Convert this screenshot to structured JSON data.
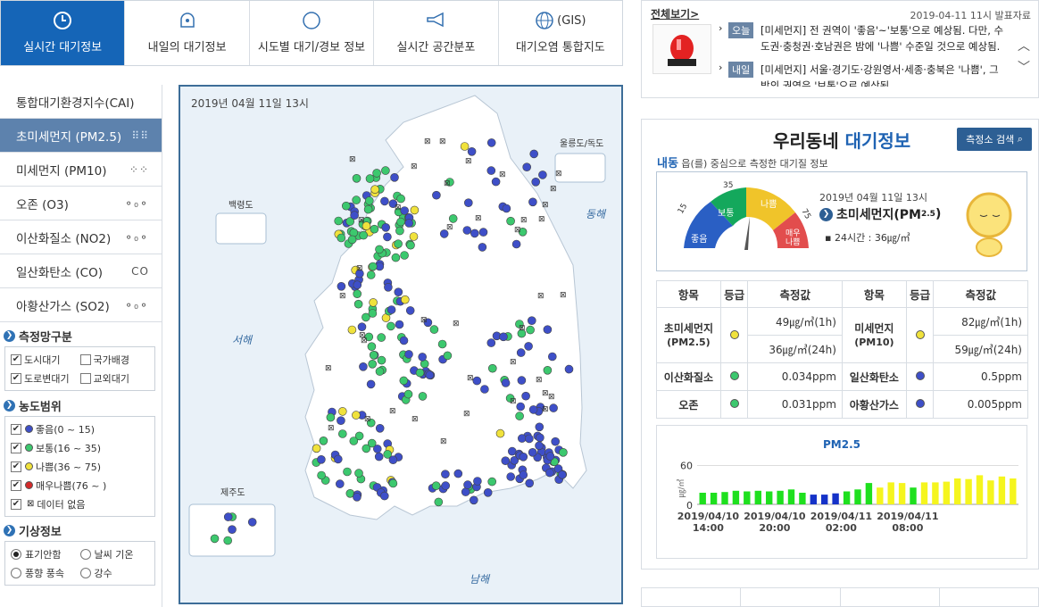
{
  "tabs": [
    {
      "label": "실시간 대기정보",
      "icon": "clock-icon",
      "active": true
    },
    {
      "label": "내일의 대기정보",
      "icon": "forecast-icon",
      "active": false
    },
    {
      "label": "시도별 대기/경보 정보",
      "icon": "compass-icon",
      "active": false
    },
    {
      "label": "실시간 공간분포",
      "icon": "megaphone-icon",
      "active": false
    },
    {
      "label": "대기오염 통합지도",
      "icon": "globe-icon",
      "icon_text": "(GIS)",
      "active": false
    }
  ],
  "menu": [
    {
      "label": "통합대기환경지수(CAI)",
      "icon": ""
    },
    {
      "label": "초미세먼지 (PM2.5)",
      "icon": "⠿⠿",
      "active": true
    },
    {
      "label": "미세먼지 (PM10)",
      "icon": "⁘⁘"
    },
    {
      "label": "오존 (O3)",
      "icon": "⚬₀⚬"
    },
    {
      "label": "이산화질소 (NO2)",
      "icon": "⚬₀⚬"
    },
    {
      "label": "일산화탄소 (CO)",
      "icon": "CO"
    },
    {
      "label": "아황산가스 (SO2)",
      "icon": "⚬₀⚬"
    }
  ],
  "network": {
    "title": "측정망구분",
    "items": [
      {
        "label": "도시대기",
        "checked": true
      },
      {
        "label": "국가배경",
        "checked": false
      },
      {
        "label": "도로변대기",
        "checked": true
      },
      {
        "label": "교외대기",
        "checked": false
      }
    ]
  },
  "range": {
    "title": "농도범위",
    "items": [
      {
        "label": "좋음(0 ~ 15)",
        "color": "#3e4fc8",
        "checked": true
      },
      {
        "label": "보통(16 ~ 35)",
        "color": "#3cc86e",
        "checked": true
      },
      {
        "label": "나쁨(36 ~ 75)",
        "color": "#f0e23c",
        "checked": true
      },
      {
        "label": "매우나쁨(76 ~ )",
        "color": "#d42a2a",
        "checked": true
      },
      {
        "label": "데이터 없음",
        "color": "none",
        "checked": true
      }
    ]
  },
  "weather": {
    "title": "기상정보",
    "items": [
      {
        "label": "표기안함",
        "on": true
      },
      {
        "label": "날씨 기온",
        "on": false
      },
      {
        "label": "풍향 풍속",
        "on": false
      },
      {
        "label": "강수",
        "on": false
      }
    ]
  },
  "map": {
    "timestamp": "2019년 04월 11일 13시",
    "labels": {
      "baek": "백령도",
      "ulleung": "울릉도/독도",
      "jeju": "제주도",
      "west_sea": "서해",
      "east_sea": "동해",
      "south_sea": "남해"
    }
  },
  "notice": {
    "view_all": "전체보기>",
    "date": "2019-04-11 11시 발표자료",
    "today_tag": "오늘",
    "tomorrow_tag": "내일",
    "today_text": "[미세먼지] 전 권역이 '좋음'~'보통'으로 예상됨. 다만, 수도권·충청권·호남권은 밤에 '나쁨' 수준일 것으로 예상됨.",
    "tomorrow_text": "[미세먼지] 서울·경기도·강원영서·세종·충북은 '나쁨', 그 밖의 권역은 '보통'으로 예상됨."
  },
  "air": {
    "title_a": "우리동네",
    "title_b": "대기정보",
    "search_btn": "측정소 검색",
    "station": "내동",
    "station_desc": "읍(를) 중심으로 측정한 대기질 정보",
    "gauge": {
      "good": "좋음",
      "normal": "보통",
      "bad": "나쁨",
      "very_bad": "매우\n나쁨",
      "t15": "15",
      "t35": "35",
      "t75": "75",
      "value": 49
    },
    "ts": "2019년 04월 11일 13시",
    "pollutant": "초미세먼지(PM",
    "pollutant_sub": "2.5",
    "avg24": "24시간 : 36㎍/㎥"
  },
  "table": {
    "headers": [
      "항목",
      "등급",
      "측정값",
      "항목",
      "등급",
      "측정값"
    ],
    "rows": [
      {
        "name1": "초미세먼지",
        "sub1": "(PM2.5)",
        "grade1": "#f0e23c",
        "val1a": "49㎍/㎥(1h)",
        "val1b": "36㎍/㎥(24h)",
        "name2": "미세먼지",
        "sub2": "(PM10)",
        "grade2": "#f0e23c",
        "val2a": "82㎍/㎥(1h)",
        "val2b": "59㎍/㎥(24h)"
      },
      {
        "name1": "이산화질소",
        "grade1": "#3cc86e",
        "val1": "0.034ppm",
        "name2": "일산화탄소",
        "grade2": "#3e4fc8",
        "val2": "0.5ppm"
      },
      {
        "name1": "오존",
        "grade1": "#3cc86e",
        "val1": "0.031ppm",
        "name2": "아황산가스",
        "grade2": "#3e4fc8",
        "val2": "0.005ppm"
      }
    ]
  },
  "chart_data": {
    "type": "bar",
    "title": "PM2.5",
    "ylabel": "㎍/㎥",
    "ylim": [
      0,
      80
    ],
    "yticks": [
      "60",
      "0"
    ],
    "xticks": [
      "2019/04/10\n14:00",
      "2019/04/10\n20:00",
      "2019/04/11\n02:00",
      "2019/04/11\n08:00"
    ],
    "values": [
      18,
      18,
      19,
      21,
      20,
      21,
      20,
      21,
      23,
      18,
      15,
      15,
      17,
      20,
      23,
      33,
      26,
      34,
      33,
      26,
      34,
      34,
      35,
      40,
      39,
      45,
      37,
      43,
      40
    ],
    "colors": [
      "#1fe01f",
      "#1fe01f",
      "#1fe01f",
      "#1fe01f",
      "#1fe01f",
      "#1fe01f",
      "#1fe01f",
      "#1fe01f",
      "#1fe01f",
      "#1fe01f",
      "#1532c8",
      "#1532c8",
      "#1532c8",
      "#1fe01f",
      "#1fe01f",
      "#1fe01f",
      "#f5f51e",
      "#f5f51e",
      "#f5f51e",
      "#1fe01f",
      "#f5f51e",
      "#f5f51e",
      "#f5f51e",
      "#f5f51e",
      "#f5f51e",
      "#f5f51e",
      "#f5f51e",
      "#f5f51e",
      "#f5f51e"
    ]
  }
}
